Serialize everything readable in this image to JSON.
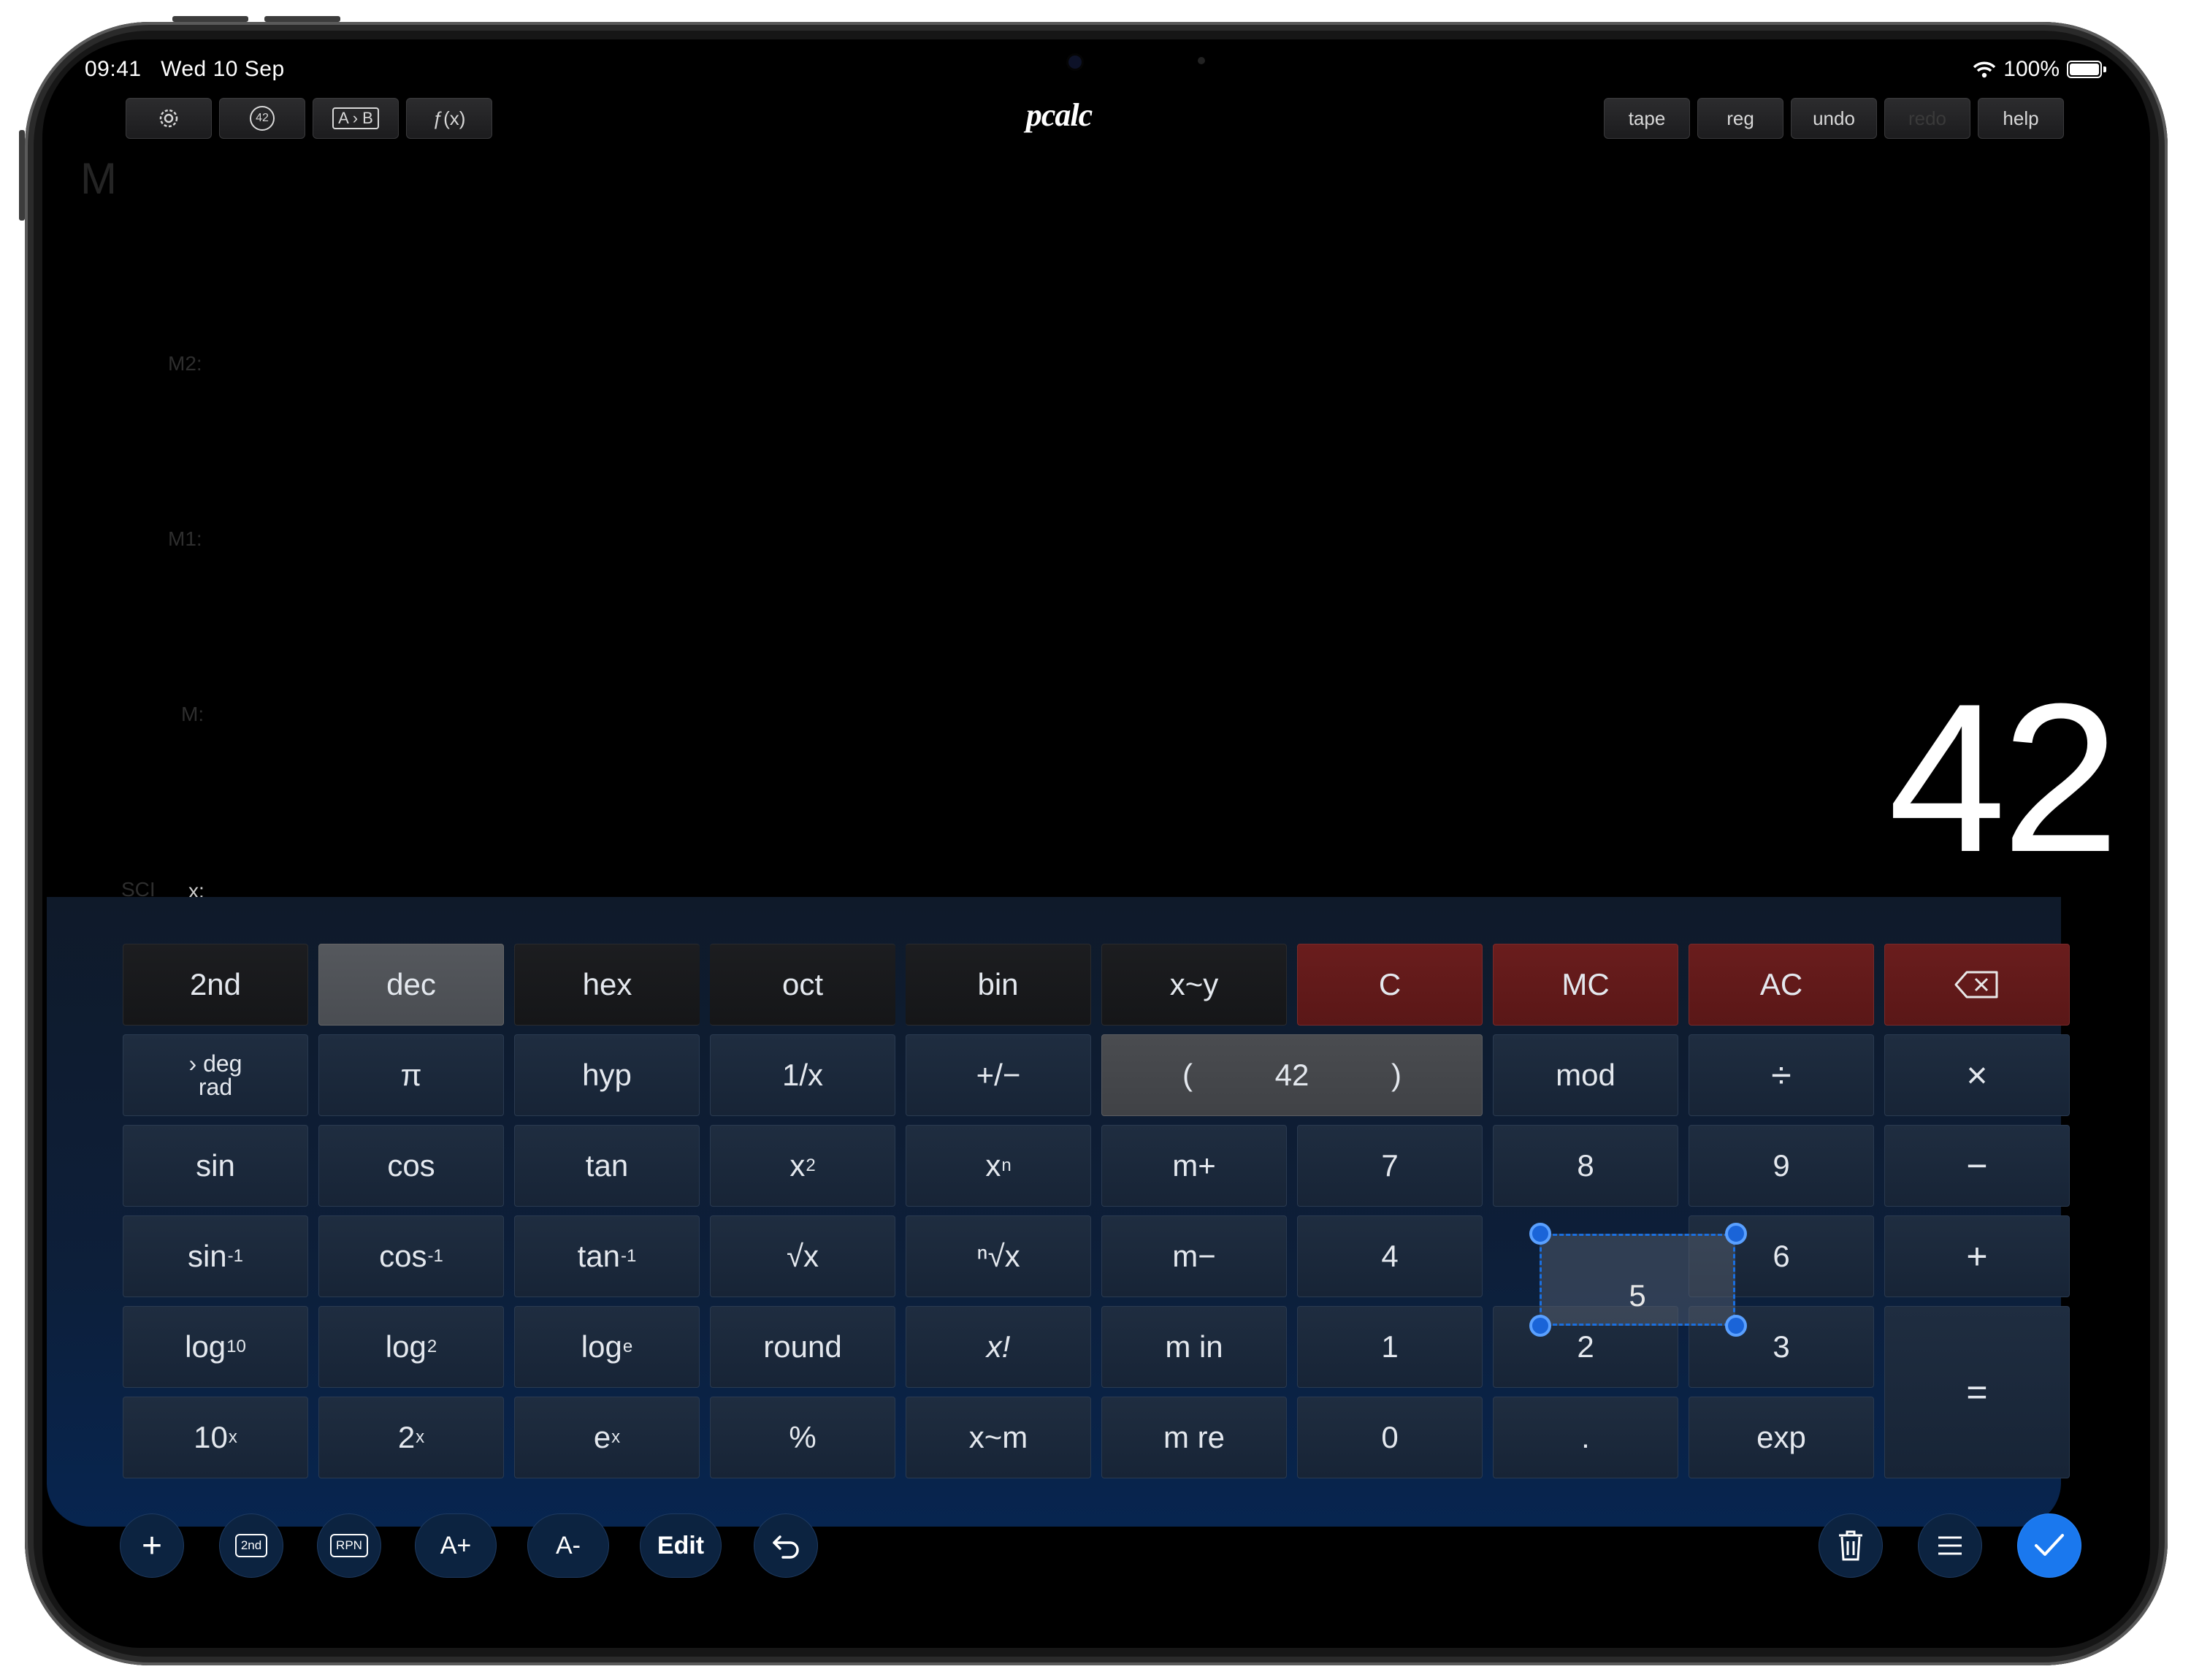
{
  "status": {
    "time": "09:41",
    "date": "Wed 10 Sep",
    "battery": "100%"
  },
  "app": {
    "title": "pcalc",
    "left_buttons": [
      "gear-icon",
      "42",
      "A › B",
      "ƒ(x)"
    ],
    "right_buttons": [
      "tape",
      "reg",
      "undo",
      "redo",
      "help"
    ]
  },
  "registers": {
    "mem": "M",
    "m2": "M2:",
    "m1": "M1:",
    "m": "M:",
    "mode": "SCI",
    "x": "x:"
  },
  "display": {
    "value": "42"
  },
  "keys": {
    "row1": [
      "2nd",
      "dec",
      "hex",
      "oct",
      "bin",
      "x~y",
      "C",
      "MC",
      "AC"
    ],
    "degrad": {
      "a": "› deg",
      "b": "rad"
    },
    "pi": "π",
    "hyp": "hyp",
    "recip": "1/x",
    "negate": "+/−",
    "paren": {
      "open": "(",
      "value": "42",
      "close": ")"
    },
    "mod": "mod",
    "divide": "÷",
    "multiply": "×",
    "sin": "sin",
    "cos": "cos",
    "tan": "tan",
    "x2": {
      "base": "x",
      "sup": "2"
    },
    "xn": {
      "base": "x",
      "sup": "n"
    },
    "mplus": "m+",
    "d7": "7",
    "d8": "8",
    "d9": "9",
    "minus": "−",
    "asin": {
      "base": "sin",
      "sup": "-1"
    },
    "acos": {
      "base": "cos",
      "sup": "-1"
    },
    "atan": {
      "base": "tan",
      "sup": "-1"
    },
    "sqrt": "√x",
    "nroot": "ⁿ√x",
    "mminus": "m−",
    "d4": "4",
    "d6": "6",
    "plus": "+",
    "log10": {
      "base": "log",
      "sub": "10"
    },
    "log2": {
      "base": "log",
      "sub": "2"
    },
    "loge": {
      "base": "log",
      "sub": "e"
    },
    "round": "round",
    "fact": "x!",
    "min": "m in",
    "d1": "1",
    "d2": "2",
    "d3": "3",
    "equals": "=",
    "p10": {
      "base": "10",
      "sup": "x"
    },
    "p2": {
      "base": "2",
      "sup": "x"
    },
    "pe": {
      "base": "e",
      "sup": "x"
    },
    "percent": "%",
    "xm": "x~m",
    "mre": "m re",
    "d0": "0",
    "dot": ".",
    "exp": "exp"
  },
  "edit": {
    "selected_key": "5"
  },
  "bottom": {
    "add": "+",
    "second": "2nd",
    "rpn": "RPN",
    "font_up": "A+",
    "font_down": "A-",
    "edit": "Edit"
  }
}
